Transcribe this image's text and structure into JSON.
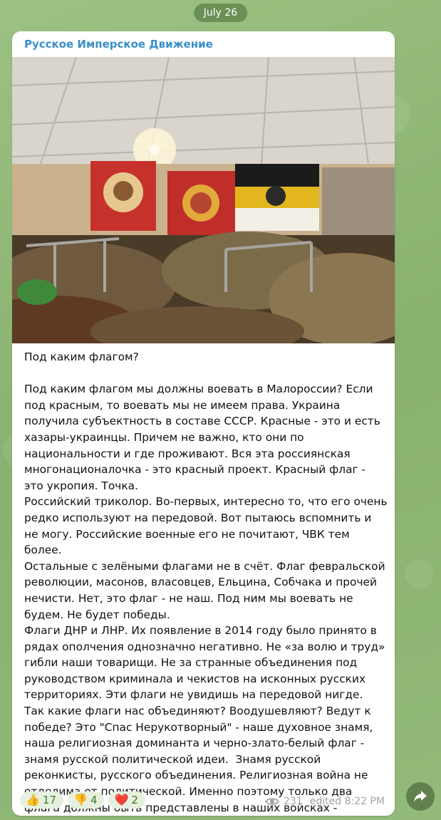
{
  "date_label": "July 26",
  "channel_name": "Русское Имперское Движение",
  "message_text": "Под каким флагом?\n\nПод каким флагом мы должны воевать в Малороссии? Если под красным, то воевать мы не имеем права. Украина получила субъектность в составе СССР. Красные - это и есть хазары-украинцы. Причем не важно, кто они по национальности и где проживают. Вся эта россиянская многонационалочка - это красный проект. Красный флаг - это укропия. Точка.\nРоссийский триколор. Во-первых, интересно то, что его очень редко используют на передовой. Вот пытаюсь вспомнить и не могу. Российские военные его не почитают, ЧВК тем более.\nОстальные с зелёными флагами не в счёт. Флаг февральской революции, масонов, власовцев, Ельцина, Собчака и прочей нечисти. Нет, это флаг - не наш. Под ним мы воевать не будем. Не будет победы.\nФлаги ДНР и ЛНР. Их появление в 2014 году было принято в рядах ополчения однозначно негативно. Не «за волю и труд» гибли наши товарищи. Не за странные объединения под руководством криминала и чекистов на исконных русских территориях. Эти флаги не увидишь на передовой нигде.\nТак какие флаги нас объединяют? Воодушевляют? Ведут к победе? Это \"Спас Нерукотворный\" - наше духовное знамя, наша религиозная доминанта и черно-злато-белый флаг - знамя русской политической идеи.  Знамя русской реконкисты, русского объединения. Религиозная война не отделима от политической. Именно поэтому только два флага должны быть представлены в наших войсках - \"Имперка\" и \"Спас\". Любое другое от лукавого!!! Слава России!!!",
  "reactions": [
    {
      "emoji": "👍",
      "count": "17"
    },
    {
      "emoji": "👎",
      "count": "4"
    },
    {
      "emoji": "❤️",
      "count": "2"
    }
  ],
  "views": "231",
  "edited_label": "edited 8:22 PM",
  "icons": {
    "views": "eye-icon",
    "share": "share-arrow-icon"
  },
  "colors": {
    "channel_name": "#3a8fc9",
    "reaction_bg": "#e6f0de",
    "reaction_text": "#3f7a2c"
  }
}
